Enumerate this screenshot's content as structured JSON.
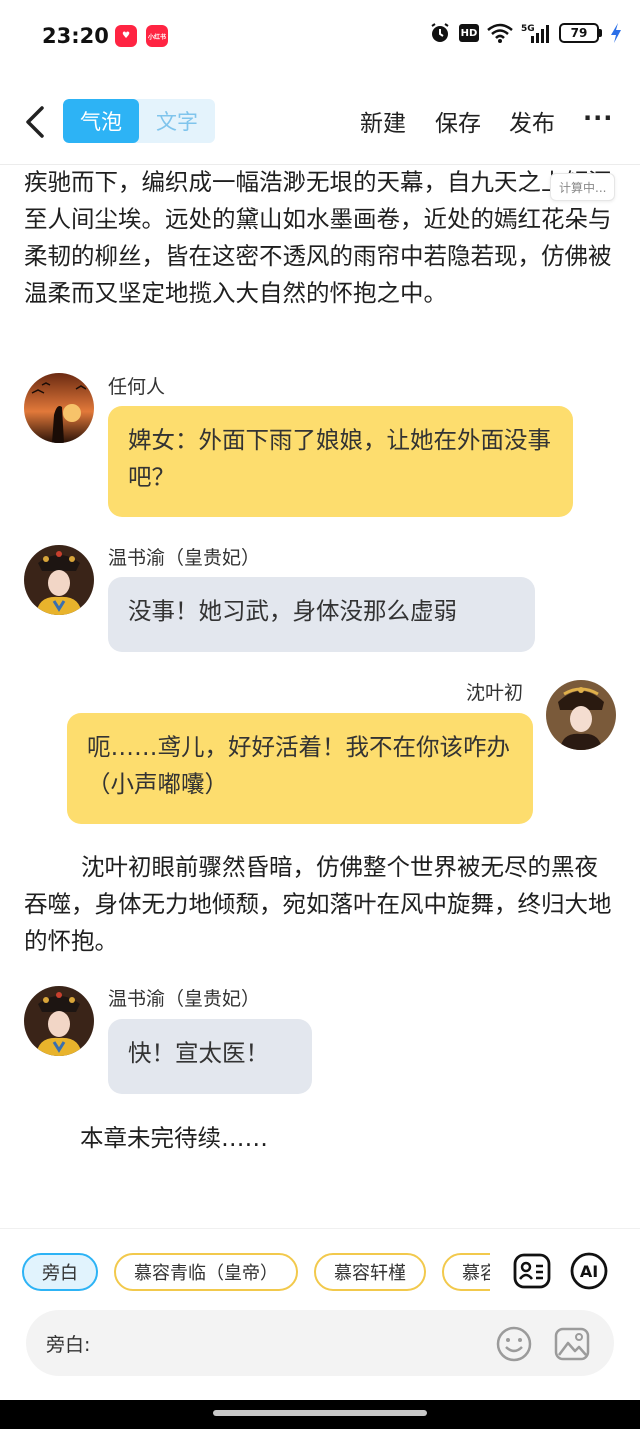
{
  "status_bar": {
    "time": "23:20",
    "app_badges": [
      "小红书"
    ],
    "network": "5G",
    "battery": 79
  },
  "toolbar": {
    "mode_bubble": "气泡",
    "mode_text": "文字",
    "new_label": "新建",
    "save_label": "保存",
    "publish_label": "发布",
    "more_label": "···"
  },
  "content": {
    "calc_tag": "计算中...",
    "narration_1": "疾驰而下，编织成一幅浩渺无垠的天幕，自九天之上倾泻至人间尘埃。远处的黛山如水墨画卷，近处的嫣红花朵与柔韧的柳丝，皆在这密不透风的雨帘中若隐若现，仿佛被温柔而又坚定地揽入大自然的怀抱之中。",
    "messages": [
      {
        "speaker": "任何人",
        "text": "婢女：外面下雨了娘娘，让她在外面没事吧？"
      },
      {
        "speaker": "温书渝（皇贵妃）",
        "text": "没事！她习武，身体没那么虚弱"
      },
      {
        "speaker": "沈叶初",
        "text": "呃……鸢儿，好好活着！我不在你该咋办（小声嘟囔）"
      }
    ],
    "narration_2": "沈叶初眼前骤然昏暗，仿佛整个世界被无尽的黑夜吞噬，身体无力地倾颓，宛如落叶在风中旋舞，终归大地的怀抱。",
    "message_4": {
      "speaker": "温书渝（皇贵妃）",
      "text": "快！宣太医！"
    },
    "ending": "本章未完待续……"
  },
  "bottom": {
    "chips": [
      "旁白",
      "慕容青临（皇帝）",
      "慕容轩槿",
      "慕容"
    ],
    "active_chip": "旁白",
    "ai_label": "AI",
    "input_label": "旁白:",
    "input_value": ""
  },
  "colors": {
    "accent": "#2db3f5",
    "yellow_bubble": "#fddd6e",
    "gray_bubble": "#e3e7ee",
    "chip_border": "#f2c94c"
  }
}
